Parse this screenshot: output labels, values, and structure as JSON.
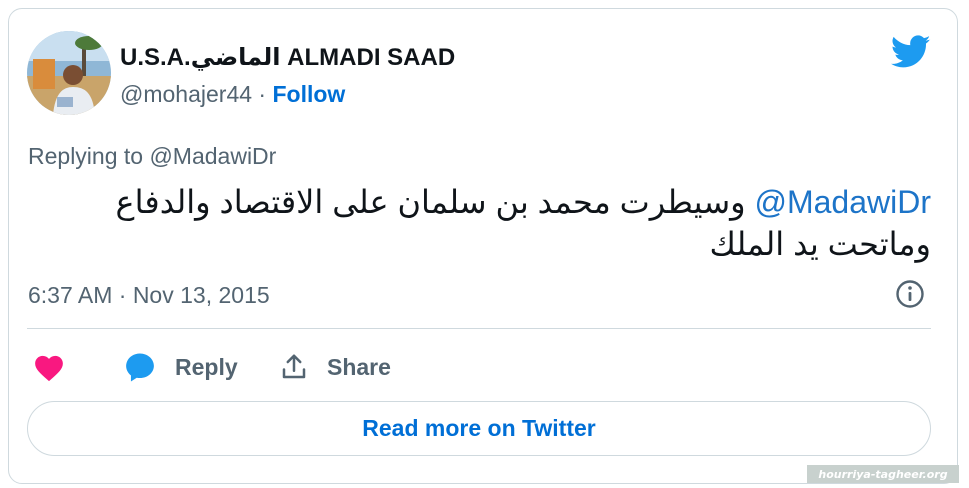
{
  "author": {
    "name": "U.S.A.الماضي ALMADI SAAD",
    "handle": "@mohajer44",
    "separator": "·",
    "follow_label": "Follow"
  },
  "tweet": {
    "replying_to": "Replying to @MadawiDr",
    "mention": "@MadawiDr",
    "text": "وسيطرت محمد بن سلمان على الاقتصاد والدفاع وماتحت يد الملك",
    "timestamp": "6:37 AM · Nov 13, 2015"
  },
  "actions": {
    "reply_label": "Reply",
    "share_label": "Share"
  },
  "read_more_label": "Read more on Twitter",
  "watermark_text": "hourriya-tagheer.org",
  "colors": {
    "link": "#006fd6",
    "like": "#f91880",
    "reply": "#1d9bf0",
    "muted": "#536471",
    "border": "#cfd9de"
  },
  "icons": [
    "twitter-bird-icon",
    "info-icon",
    "heart-icon",
    "reply-bubble-icon",
    "share-icon"
  ]
}
